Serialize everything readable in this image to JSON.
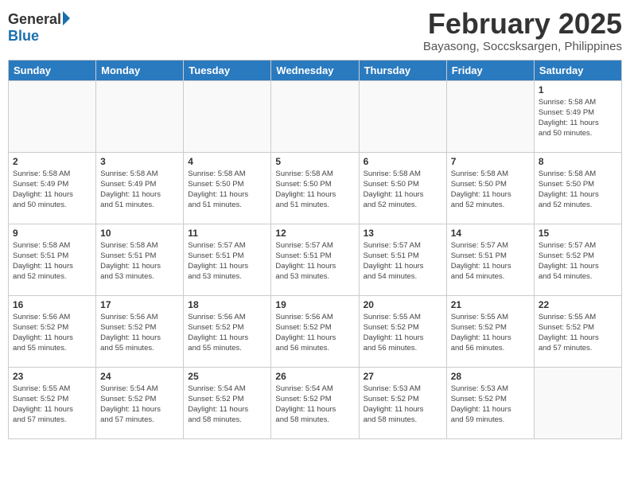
{
  "header": {
    "logo_general": "General",
    "logo_blue": "Blue",
    "month": "February 2025",
    "location": "Bayasong, Soccsksargen, Philippines"
  },
  "weekdays": [
    "Sunday",
    "Monday",
    "Tuesday",
    "Wednesday",
    "Thursday",
    "Friday",
    "Saturday"
  ],
  "weeks": [
    [
      {
        "day": "",
        "info": ""
      },
      {
        "day": "",
        "info": ""
      },
      {
        "day": "",
        "info": ""
      },
      {
        "day": "",
        "info": ""
      },
      {
        "day": "",
        "info": ""
      },
      {
        "day": "",
        "info": ""
      },
      {
        "day": "1",
        "info": "Sunrise: 5:58 AM\nSunset: 5:49 PM\nDaylight: 11 hours\nand 50 minutes."
      }
    ],
    [
      {
        "day": "2",
        "info": "Sunrise: 5:58 AM\nSunset: 5:49 PM\nDaylight: 11 hours\nand 50 minutes."
      },
      {
        "day": "3",
        "info": "Sunrise: 5:58 AM\nSunset: 5:49 PM\nDaylight: 11 hours\nand 51 minutes."
      },
      {
        "day": "4",
        "info": "Sunrise: 5:58 AM\nSunset: 5:50 PM\nDaylight: 11 hours\nand 51 minutes."
      },
      {
        "day": "5",
        "info": "Sunrise: 5:58 AM\nSunset: 5:50 PM\nDaylight: 11 hours\nand 51 minutes."
      },
      {
        "day": "6",
        "info": "Sunrise: 5:58 AM\nSunset: 5:50 PM\nDaylight: 11 hours\nand 52 minutes."
      },
      {
        "day": "7",
        "info": "Sunrise: 5:58 AM\nSunset: 5:50 PM\nDaylight: 11 hours\nand 52 minutes."
      },
      {
        "day": "8",
        "info": "Sunrise: 5:58 AM\nSunset: 5:50 PM\nDaylight: 11 hours\nand 52 minutes."
      }
    ],
    [
      {
        "day": "9",
        "info": "Sunrise: 5:58 AM\nSunset: 5:51 PM\nDaylight: 11 hours\nand 52 minutes."
      },
      {
        "day": "10",
        "info": "Sunrise: 5:58 AM\nSunset: 5:51 PM\nDaylight: 11 hours\nand 53 minutes."
      },
      {
        "day": "11",
        "info": "Sunrise: 5:57 AM\nSunset: 5:51 PM\nDaylight: 11 hours\nand 53 minutes."
      },
      {
        "day": "12",
        "info": "Sunrise: 5:57 AM\nSunset: 5:51 PM\nDaylight: 11 hours\nand 53 minutes."
      },
      {
        "day": "13",
        "info": "Sunrise: 5:57 AM\nSunset: 5:51 PM\nDaylight: 11 hours\nand 54 minutes."
      },
      {
        "day": "14",
        "info": "Sunrise: 5:57 AM\nSunset: 5:51 PM\nDaylight: 11 hours\nand 54 minutes."
      },
      {
        "day": "15",
        "info": "Sunrise: 5:57 AM\nSunset: 5:52 PM\nDaylight: 11 hours\nand 54 minutes."
      }
    ],
    [
      {
        "day": "16",
        "info": "Sunrise: 5:56 AM\nSunset: 5:52 PM\nDaylight: 11 hours\nand 55 minutes."
      },
      {
        "day": "17",
        "info": "Sunrise: 5:56 AM\nSunset: 5:52 PM\nDaylight: 11 hours\nand 55 minutes."
      },
      {
        "day": "18",
        "info": "Sunrise: 5:56 AM\nSunset: 5:52 PM\nDaylight: 11 hours\nand 55 minutes."
      },
      {
        "day": "19",
        "info": "Sunrise: 5:56 AM\nSunset: 5:52 PM\nDaylight: 11 hours\nand 56 minutes."
      },
      {
        "day": "20",
        "info": "Sunrise: 5:55 AM\nSunset: 5:52 PM\nDaylight: 11 hours\nand 56 minutes."
      },
      {
        "day": "21",
        "info": "Sunrise: 5:55 AM\nSunset: 5:52 PM\nDaylight: 11 hours\nand 56 minutes."
      },
      {
        "day": "22",
        "info": "Sunrise: 5:55 AM\nSunset: 5:52 PM\nDaylight: 11 hours\nand 57 minutes."
      }
    ],
    [
      {
        "day": "23",
        "info": "Sunrise: 5:55 AM\nSunset: 5:52 PM\nDaylight: 11 hours\nand 57 minutes."
      },
      {
        "day": "24",
        "info": "Sunrise: 5:54 AM\nSunset: 5:52 PM\nDaylight: 11 hours\nand 57 minutes."
      },
      {
        "day": "25",
        "info": "Sunrise: 5:54 AM\nSunset: 5:52 PM\nDaylight: 11 hours\nand 58 minutes."
      },
      {
        "day": "26",
        "info": "Sunrise: 5:54 AM\nSunset: 5:52 PM\nDaylight: 11 hours\nand 58 minutes."
      },
      {
        "day": "27",
        "info": "Sunrise: 5:53 AM\nSunset: 5:52 PM\nDaylight: 11 hours\nand 58 minutes."
      },
      {
        "day": "28",
        "info": "Sunrise: 5:53 AM\nSunset: 5:52 PM\nDaylight: 11 hours\nand 59 minutes."
      },
      {
        "day": "",
        "info": ""
      }
    ]
  ]
}
